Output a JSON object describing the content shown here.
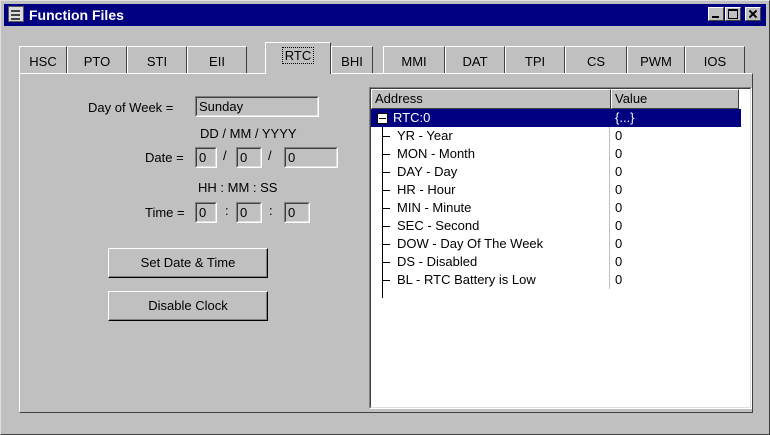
{
  "window": {
    "title": "Function Files"
  },
  "tabs": [
    {
      "label": "HSC"
    },
    {
      "label": "PTO"
    },
    {
      "label": "STI"
    },
    {
      "label": "EII"
    },
    {
      "label": "RTC",
      "active": true
    },
    {
      "label": "BHI"
    },
    {
      "label": "MMI"
    },
    {
      "label": "DAT"
    },
    {
      "label": "TPI"
    },
    {
      "label": "CS"
    },
    {
      "label": "PWM"
    },
    {
      "label": "IOS"
    }
  ],
  "rtc_form": {
    "day_of_week_label": "Day of Week =",
    "day_of_week_value": "Sunday",
    "date_format_hint": "DD / MM / YYYY",
    "date_label": "Date =",
    "date_dd": "0",
    "date_mm": "0",
    "date_yyyy": "0",
    "date_sep1": "/",
    "date_sep2": "/",
    "time_format_hint": "HH : MM : SS",
    "time_label": "Time =",
    "time_hh": "0",
    "time_mm": "0",
    "time_ss": "0",
    "time_sep1": ":",
    "time_sep2": ":",
    "set_button": "Set Date & Time",
    "disable_button": "Disable Clock"
  },
  "tree": {
    "columns": {
      "address": "Address",
      "value": "Value"
    },
    "root": {
      "address": "RTC:0",
      "value": "{...}"
    },
    "rows": [
      {
        "address": "YR - Year",
        "value": "0"
      },
      {
        "address": "MON - Month",
        "value": "0"
      },
      {
        "address": "DAY - Day",
        "value": "0"
      },
      {
        "address": "HR - Hour",
        "value": "0"
      },
      {
        "address": "MIN - Minute",
        "value": "0"
      },
      {
        "address": "SEC - Second",
        "value": "0"
      },
      {
        "address": "DOW - Day Of The Week",
        "value": "0"
      },
      {
        "address": "DS - Disabled",
        "value": "0"
      },
      {
        "address": "BL - RTC Battery is Low",
        "value": "0"
      }
    ]
  },
  "colors": {
    "titlebar": "#000080",
    "face": "#c0c0c0",
    "selection": "#000080"
  }
}
